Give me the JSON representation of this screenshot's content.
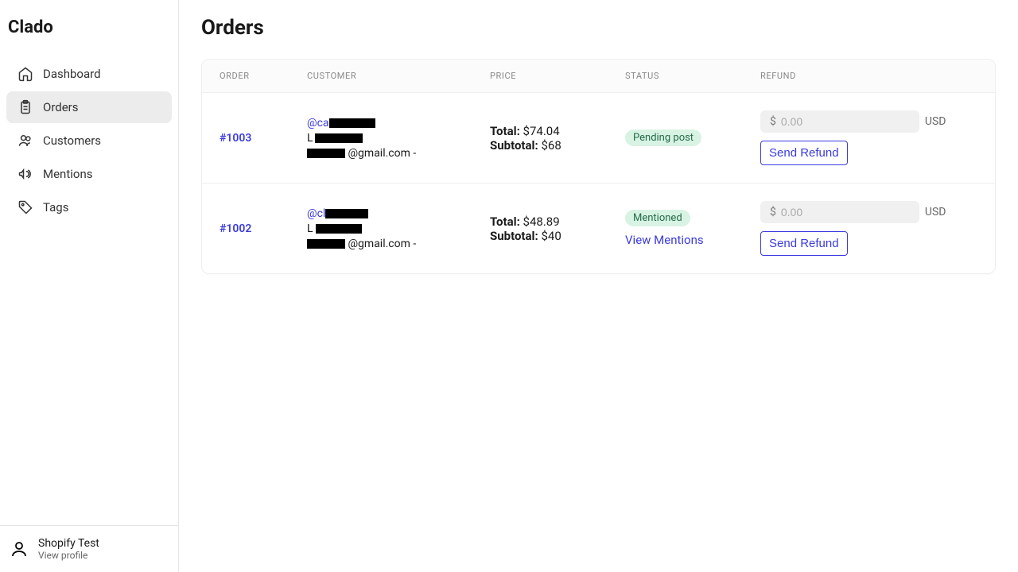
{
  "brand": "Clado",
  "nav": [
    {
      "key": "dashboard",
      "label": "Dashboard"
    },
    {
      "key": "orders",
      "label": "Orders",
      "active": true
    },
    {
      "key": "customers",
      "label": "Customers"
    },
    {
      "key": "mentions",
      "label": "Mentions"
    },
    {
      "key": "tags",
      "label": "Tags"
    }
  ],
  "profile": {
    "name": "Shopify Test",
    "sub": "View profile"
  },
  "page": {
    "title": "Orders"
  },
  "columns": {
    "order": "ORDER",
    "customer": "CUSTOMER",
    "price": "PRICE",
    "status": "STATUS",
    "refund": "REFUND"
  },
  "labels": {
    "total": "Total:",
    "subtotal": "Subtotal:",
    "send_refund": "Send Refund",
    "currency": "USD",
    "currency_symbol": "$",
    "refund_placeholder": "0.00",
    "view_mentions": "View Mentions"
  },
  "orders": [
    {
      "id": "#1003",
      "handle_prefix": "@ca",
      "name_prefix": "L",
      "email_suffix": "@gmail.com -",
      "total": "$74.04",
      "subtotal": "$68",
      "status": "Pending post",
      "has_mentions": false
    },
    {
      "id": "#1002",
      "handle_prefix": "@cl",
      "name_prefix": "L",
      "email_suffix": "@gmail.com -",
      "total": "$48.89",
      "subtotal": "$40",
      "status": "Mentioned",
      "has_mentions": true
    }
  ]
}
